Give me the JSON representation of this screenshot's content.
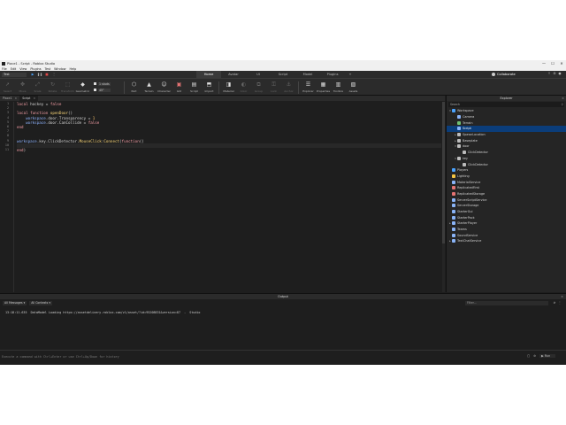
{
  "window": {
    "title": "Place1 - Script - Roblox Studio",
    "minimize": "—",
    "maximize": "☐",
    "close": "✕"
  },
  "menu": [
    "File",
    "Edit",
    "View",
    "Plugins",
    "Test",
    "Window",
    "Help"
  ],
  "mode_selector": "Test",
  "ribbon_tabs": [
    {
      "label": "Home",
      "active": true
    },
    {
      "label": "Avatar",
      "active": false
    },
    {
      "label": "UI",
      "active": false
    },
    {
      "label": "Script",
      "active": false
    },
    {
      "label": "Model",
      "active": false
    },
    {
      "label": "Plugins",
      "active": false
    }
  ],
  "collaborate_label": "Collaborate",
  "tools_left": [
    {
      "label": "Select",
      "icon": "cursor-icon"
    },
    {
      "label": "Move",
      "icon": "move-icon"
    },
    {
      "label": "Scale",
      "icon": "scale-icon"
    },
    {
      "label": "Rotate",
      "icon": "rotate-icon"
    },
    {
      "label": "Transform",
      "icon": "transform-icon"
    },
    {
      "label": "Geometric",
      "icon": "geometric-icon"
    }
  ],
  "snap": {
    "move_value": "1 studs",
    "rotate_value": "45°"
  },
  "tools_right": [
    {
      "label": "Part",
      "icon": "part-icon"
    },
    {
      "label": "Terrain",
      "icon": "terrain-icon"
    },
    {
      "label": "Character",
      "icon": "character-icon"
    },
    {
      "label": "GUI",
      "icon": "gui-icon"
    },
    {
      "label": "Script",
      "icon": "script-icon"
    },
    {
      "label": "Import",
      "icon": "import-icon"
    },
    {
      "label": "Material",
      "icon": "material-icon"
    },
    {
      "label": "Color",
      "icon": "color-icon"
    },
    {
      "label": "Group",
      "icon": "group-icon"
    },
    {
      "label": "Lock",
      "icon": "lock-icon"
    },
    {
      "label": "Anchor",
      "icon": "anchor-icon"
    },
    {
      "label": "Explorer",
      "icon": "explorer-icon"
    },
    {
      "label": "Properties",
      "icon": "properties-icon"
    },
    {
      "label": "Toolbox",
      "icon": "toolbox-icon"
    },
    {
      "label": "Assets",
      "icon": "assets-icon"
    }
  ],
  "doc_tabs": [
    {
      "label": "Place1",
      "active": false
    },
    {
      "label": "Script",
      "active": true
    }
  ],
  "code_lines": [
    "local hockey = false",
    "",
    "local function openDoor()",
    "    workspace.door.Transparency = 1",
    "    workspace.door.CanCollide = false",
    "end",
    "",
    "",
    "workspace.key.ClickDetector.MouseClick:Connect(function()",
    "",
    "end)"
  ],
  "explorer": {
    "title": "Explorer",
    "search_placeholder": "Search",
    "items": [
      {
        "label": "Workspace",
        "depth": 0,
        "arrow": "▾",
        "color": "#4aa3ff"
      },
      {
        "label": "Camera",
        "depth": 1,
        "arrow": "",
        "color": "#8ab4f8"
      },
      {
        "label": "Terrain",
        "depth": 1,
        "arrow": "",
        "color": "#6fbf73"
      },
      {
        "label": "Script",
        "depth": 1,
        "arrow": "",
        "color": "#8ab4f8",
        "selected": true
      },
      {
        "label": "SpawnLocation",
        "depth": 1,
        "arrow": "▸",
        "color": "#bdbdbd"
      },
      {
        "label": "Baseplate",
        "depth": 1,
        "arrow": "▸",
        "color": "#bdbdbd"
      },
      {
        "label": "door",
        "depth": 1,
        "arrow": "▾",
        "color": "#bdbdbd"
      },
      {
        "label": "ClickDetector",
        "depth": 2,
        "arrow": "",
        "color": "#bbbbbb"
      },
      {
        "label": "key",
        "depth": 1,
        "arrow": "▾",
        "color": "#bdbdbd"
      },
      {
        "label": "ClickDetector",
        "depth": 2,
        "arrow": "",
        "color": "#bbbbbb"
      },
      {
        "label": "Players",
        "depth": 0,
        "arrow": "",
        "color": "#4aa3ff"
      },
      {
        "label": "Lighting",
        "depth": 0,
        "arrow": "",
        "color": "#f5c542"
      },
      {
        "label": "MaterialService",
        "depth": 0,
        "arrow": "",
        "color": "#8ab4f8"
      },
      {
        "label": "ReplicatedFirst",
        "depth": 0,
        "arrow": "",
        "color": "#e57373"
      },
      {
        "label": "ReplicatedStorage",
        "depth": 0,
        "arrow": "",
        "color": "#e57373"
      },
      {
        "label": "ServerScriptService",
        "depth": 0,
        "arrow": "",
        "color": "#8ab4f8"
      },
      {
        "label": "ServerStorage",
        "depth": 0,
        "arrow": "",
        "color": "#8ab4f8"
      },
      {
        "label": "StarterGui",
        "depth": 0,
        "arrow": "",
        "color": "#8ab4f8"
      },
      {
        "label": "StarterPack",
        "depth": 0,
        "arrow": "",
        "color": "#8ab4f8"
      },
      {
        "label": "StarterPlayer",
        "depth": 0,
        "arrow": "▸",
        "color": "#8ab4f8"
      },
      {
        "label": "Teams",
        "depth": 0,
        "arrow": "",
        "color": "#8ab4f8"
      },
      {
        "label": "SoundService",
        "depth": 0,
        "arrow": "",
        "color": "#8ab4f8"
      },
      {
        "label": "TextChatService",
        "depth": 0,
        "arrow": "▸",
        "color": "#8ab4f8"
      }
    ]
  },
  "output": {
    "title": "Output",
    "messages_filter": "All Messages",
    "contexts_filter": "All Contexts",
    "filter_placeholder": "Filter...",
    "log": "13:18:11.635  DataModel Loading https://assetdelivery.roblox.com/v1/asset/?id=95208831&version=87  -  Studio"
  },
  "command_bar": {
    "placeholder": "Execute a command with Ctrl+Enter or use Ctrl+Up/Down for history",
    "run_label": "Run"
  }
}
